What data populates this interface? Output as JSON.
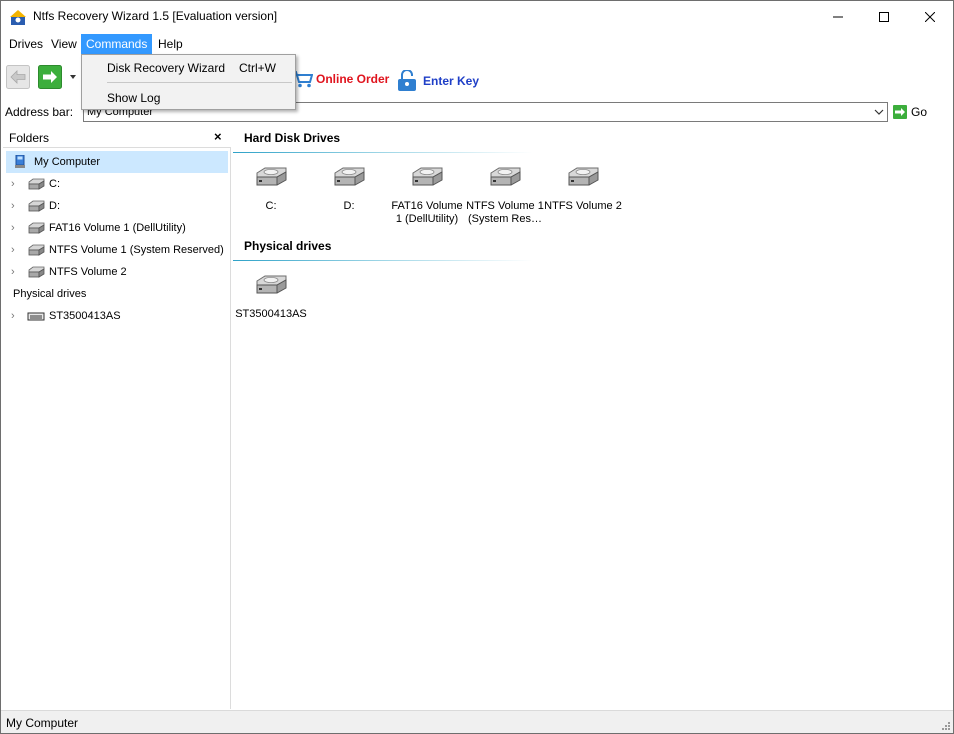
{
  "window": {
    "title": "Ntfs Recovery Wizard 1.5 [Evaluation version]"
  },
  "menubar": {
    "items": [
      {
        "label": "Drives"
      },
      {
        "label": "View"
      },
      {
        "label": "Commands"
      },
      {
        "label": "Help"
      }
    ]
  },
  "commands_menu": {
    "items": [
      {
        "label": "Disk Recovery Wizard",
        "shortcut": "Ctrl+W"
      },
      {
        "label": "Show Log",
        "shortcut": ""
      }
    ]
  },
  "toolbar": {
    "online_order_label": "Online Order",
    "enter_key_label": "Enter Key",
    "colors": {
      "online_order": "#e0141e",
      "enter_key": "#1f3fc7",
      "nav_forward": "#3cae3c"
    }
  },
  "address": {
    "label": "Address bar:",
    "value": "My Computer",
    "go_label": "Go"
  },
  "folders": {
    "title": "Folders",
    "root": "My Computer",
    "drives": [
      {
        "label": "C:"
      },
      {
        "label": "D:"
      },
      {
        "label": "FAT16 Volume 1 (DellUtility)"
      },
      {
        "label": "NTFS Volume 1 (System Reserved)"
      },
      {
        "label": "NTFS Volume 2"
      }
    ],
    "physical_group": "Physical drives",
    "physical": [
      {
        "label": "ST3500413AS"
      }
    ]
  },
  "content": {
    "hard_disk_heading": "Hard Disk Drives",
    "hard_disks": [
      {
        "label": "C:"
      },
      {
        "label": "D:"
      },
      {
        "label": "FAT16 Volume 1 (DellUtility)"
      },
      {
        "label": "NTFS Volume 1 (System Res…"
      },
      {
        "label": "NTFS Volume 2"
      }
    ],
    "physical_heading": "Physical drives",
    "physical": [
      {
        "label": "ST3500413AS"
      }
    ]
  },
  "status": {
    "text": "My Computer"
  }
}
